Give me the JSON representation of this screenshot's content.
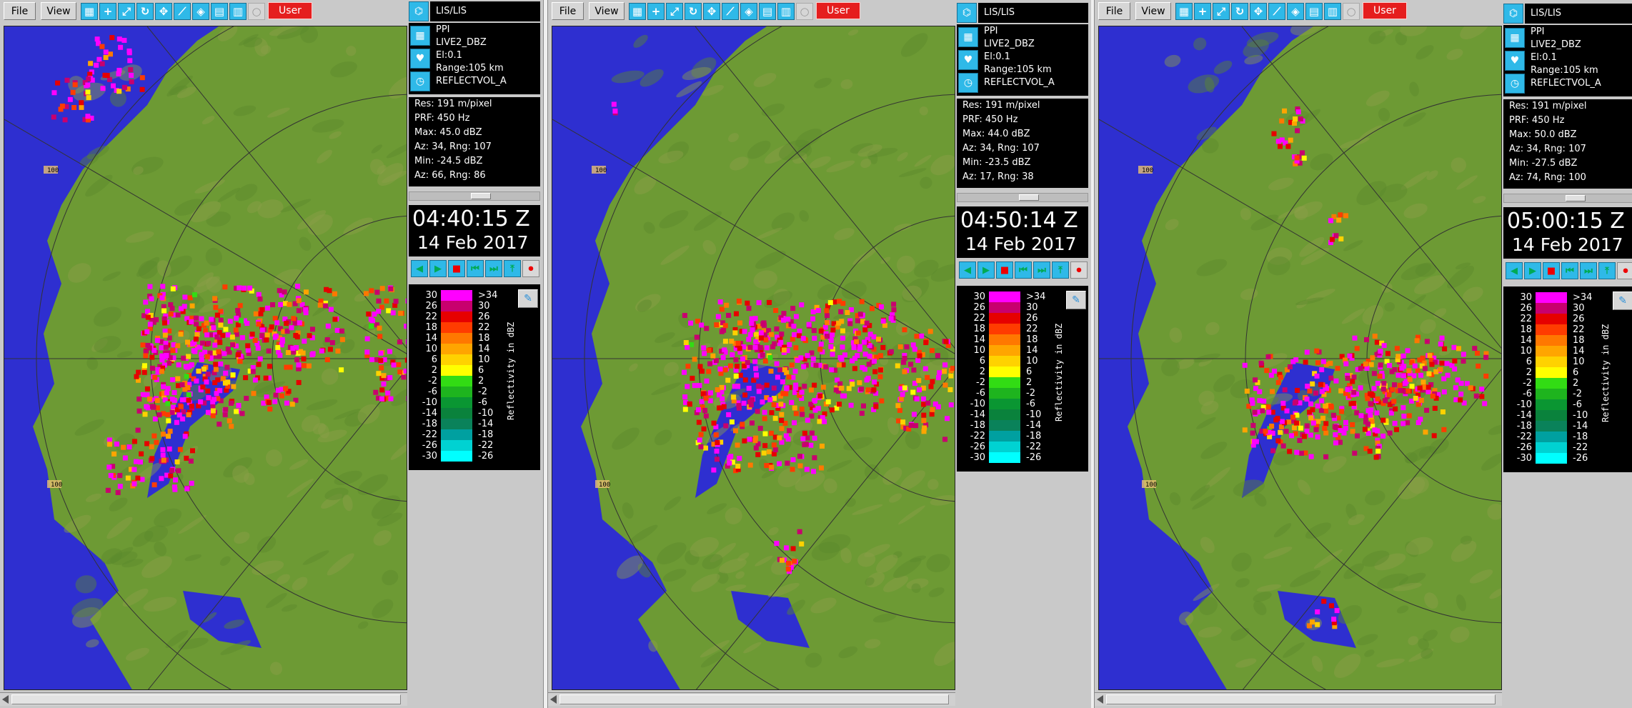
{
  "toolbar": {
    "file_label": "File",
    "view_label": "View",
    "user_label": "User",
    "user_color": "#e51e1e",
    "tool_icons": [
      "grid-icon",
      "crosshair-icon",
      "zoom-icon",
      "refresh-icon",
      "pan-icon",
      "measure-icon",
      "overlay-icon",
      "palette-icon",
      "table-icon",
      "disabled-icon"
    ]
  },
  "legend": {
    "unit": "Reflectivity in dBZ",
    "left_values": [
      "30",
      "26",
      "22",
      "18",
      "14",
      "10",
      "6",
      "2",
      "-2",
      "-6",
      "-10",
      "-14",
      "-18",
      "-22",
      "-26",
      "-30"
    ],
    "right_values": [
      ">34",
      "30",
      "26",
      "22",
      "18",
      "14",
      "10",
      "6",
      "2",
      "-2",
      "-6",
      "-10",
      "-14",
      "-18",
      "-22",
      "-26"
    ],
    "colors": [
      "#ff00ff",
      "#c8006e",
      "#e60000",
      "#ff3c00",
      "#ff7800",
      "#ffa500",
      "#ffd200",
      "#ffff00",
      "#32dc14",
      "#1eb41e",
      "#0a9632",
      "#0a823c",
      "#0a825a",
      "#00a0a0",
      "#00d2d2",
      "#00ffff"
    ]
  },
  "map": {
    "range_label": "100",
    "sea_color": "#2e2fd0",
    "land_color": "#6d9a34"
  },
  "panels": [
    {
      "site": "LIS/LIS",
      "mode": "PPI",
      "field": "LIVE2_DBZ",
      "elevation": "El:0.1",
      "range": "Range:105 km",
      "volume": "REFLECTVOL_A",
      "res": "Res: 191 m/pixel",
      "prf": "PRF: 450 Hz",
      "max": "Max: 45.0 dBZ",
      "max_loc": "Az:  34, Rng: 107",
      "min": "Min: -24.5 dBZ",
      "min_loc": "Az:  66, Rng: 86",
      "time": "04:40:15 Z",
      "date": "14 Feb 2017"
    },
    {
      "site": "LIS/LIS",
      "mode": "PPI",
      "field": "LIVE2_DBZ",
      "elevation": "El:0.1",
      "range": "Range:105 km",
      "volume": "REFLECTVOL_A",
      "res": "Res: 191 m/pixel",
      "prf": "PRF: 450 Hz",
      "max": "Max: 44.0 dBZ",
      "max_loc": "Az:  34, Rng: 107",
      "min": "Min: -23.5 dBZ",
      "min_loc": "Az:  17, Rng: 38",
      "time": "04:50:14 Z",
      "date": "14 Feb 2017"
    },
    {
      "site": "LIS/LIS",
      "mode": "PPI",
      "field": "LIVE2_DBZ",
      "elevation": "El:0.1",
      "range": "Range:105 km",
      "volume": "REFLECTVOL_A",
      "res": "Res: 191 m/pixel",
      "prf": "PRF: 450 Hz",
      "max": "Max: 50.0 dBZ",
      "max_loc": "Az:  34, Rng: 107",
      "min": "Min: -27.5 dBZ",
      "min_loc": "Az:  74, Rng: 100",
      "time": "05:00:15 Z",
      "date": "14 Feb 2017"
    }
  ]
}
